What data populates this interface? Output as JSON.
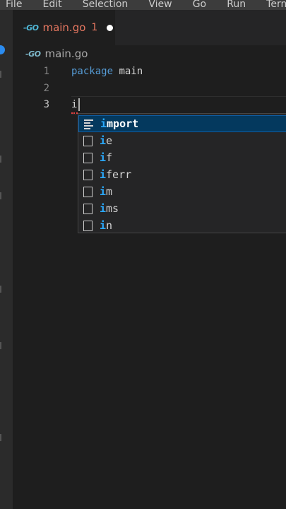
{
  "menu": [
    "File",
    "Edit",
    "Selection",
    "View",
    "Go",
    "Run",
    "Terminal"
  ],
  "tab": {
    "icon": "go-file-icon",
    "filename": "main.go",
    "problems": "1"
  },
  "breadcrumb": {
    "icon": "go-file-icon",
    "filename": "main.go"
  },
  "editor": {
    "lines": [
      {
        "number": "1",
        "keyword": "package",
        "text": " main"
      },
      {
        "number": "2",
        "keyword": "",
        "text": ""
      },
      {
        "number": "3",
        "keyword": "",
        "text": "i"
      }
    ]
  },
  "suggestions": {
    "typed_prefix": "i",
    "items": [
      {
        "icon": "snippet-icon",
        "match": "i",
        "rest": "mport",
        "selected": true
      },
      {
        "icon": "keyword-icon",
        "match": "i",
        "rest": "e"
      },
      {
        "icon": "keyword-icon",
        "match": "i",
        "rest": "f"
      },
      {
        "icon": "keyword-icon",
        "match": "i",
        "rest": "ferr"
      },
      {
        "icon": "keyword-icon",
        "match": "i",
        "rest": "m"
      },
      {
        "icon": "keyword-icon",
        "match": "i",
        "rest": "ms"
      },
      {
        "icon": "keyword-icon",
        "match": "i",
        "rest": "n"
      }
    ]
  },
  "colors": {
    "accent": "#2aaaff",
    "error": "#e87861",
    "background": "#1e1e1e"
  }
}
